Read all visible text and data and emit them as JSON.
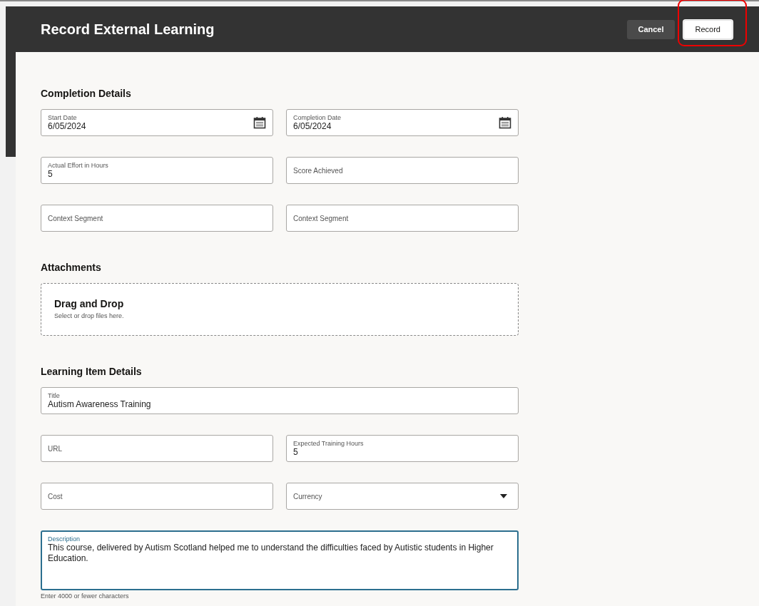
{
  "header": {
    "title": "Record External Learning",
    "buttons": [
      {
        "label": "Cancel",
        "kind": "secondary",
        "highlighted": false
      },
      {
        "label": "Record",
        "kind": "primary",
        "highlighted": true
      }
    ]
  },
  "sections": [
    {
      "title": "Completion Details",
      "kind": "fields",
      "fields": [
        {
          "label": "Start Date",
          "value": "6/05/2024",
          "kind": "date",
          "focused": false
        },
        {
          "label": "Completion Date",
          "value": "6/05/2024",
          "kind": "date",
          "focused": false
        },
        {
          "label": "Actual Effort in Hours",
          "value": "5",
          "kind": "text",
          "focused": false
        },
        {
          "label": "Score Achieved",
          "kind": "text",
          "focused": false
        },
        {
          "label": "Context Segment",
          "kind": "text",
          "focused": false
        },
        {
          "label": "Context Segment",
          "kind": "text",
          "focused": false
        }
      ]
    },
    {
      "title": "Attachments",
      "kind": "dropzone",
      "dropzone": {
        "title": "Drag and Drop",
        "hint": "Select or drop files here."
      }
    },
    {
      "title": "Learning Item Details",
      "kind": "fields",
      "fields": [
        {
          "label": "Title",
          "value": "Autism Awareness Training",
          "kind": "text",
          "wide": true,
          "focused": false
        },
        {
          "label": "URL",
          "kind": "text",
          "focused": false
        },
        {
          "label": "Expected Training Hours",
          "value": "5",
          "kind": "text",
          "focused": false
        },
        {
          "label": "Cost",
          "kind": "text",
          "focused": false
        },
        {
          "label": "Currency",
          "kind": "select",
          "focused": false
        },
        {
          "label": "Description",
          "value": "This course, delivered by Autism Scotland helped me to understand  the difficulties faced by Autistic students in Higher Education.",
          "kind": "textarea",
          "wide": true,
          "focused": true,
          "helper": "Enter 4000 or fewer characters"
        }
      ]
    }
  ]
}
